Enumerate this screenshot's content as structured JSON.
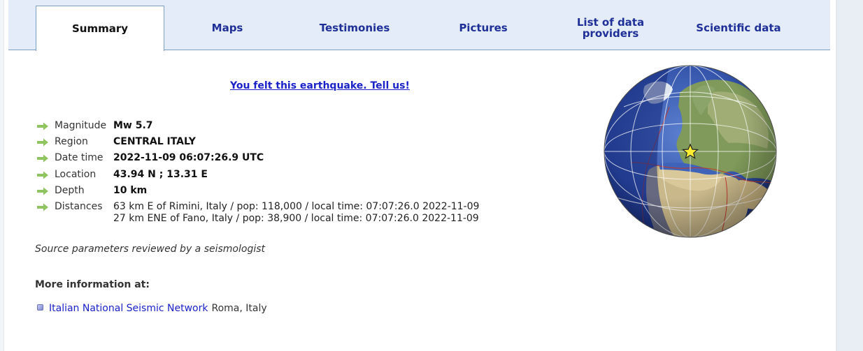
{
  "tabs": [
    {
      "label": "Summary",
      "active": true
    },
    {
      "label": "Maps",
      "active": false
    },
    {
      "label": "Testimonies",
      "active": false
    },
    {
      "label": "Pictures",
      "active": false
    },
    {
      "label": "List of data providers",
      "active": false
    },
    {
      "label": "Scientific data",
      "active": false
    }
  ],
  "felt_link": "You felt this earthquake. Tell us!",
  "parameters": {
    "magnitude": {
      "label": "Magnitude",
      "value": "Mw 5.7"
    },
    "region": {
      "label": "Region",
      "value": "CENTRAL ITALY"
    },
    "datetime": {
      "label": "Date time",
      "value": "2022-11-09 06:07:26.9 UTC"
    },
    "location": {
      "label": "Location",
      "value": "43.94 N ; 13.31 E"
    },
    "depth": {
      "label": "Depth",
      "value": "10 km"
    },
    "distances": {
      "label": "Distances",
      "lines": [
        "63 km E of Rimini, Italy / pop: 118,000 / local time: 07:07:26.0 2022-11-09",
        "27 km ENE of Fano, Italy / pop: 38,900 / local time: 07:07:26.0 2022-11-09"
      ]
    }
  },
  "review_note": "Source parameters reviewed by a seismologist",
  "more_info": {
    "title": "More information at:",
    "providers": [
      {
        "name": "Italian National Seismic Network",
        "location": "Roma, Italy"
      }
    ]
  },
  "colors": {
    "tab_text": "#1f2f98",
    "link": "#1a22c8",
    "arrow": "#8fc460",
    "tab_bg": "#e3ecf8"
  },
  "icons": {
    "parameter_bullet": "green-arrow-icon",
    "provider_bullet": "square-bullet-icon",
    "epicenter": "star-icon"
  }
}
